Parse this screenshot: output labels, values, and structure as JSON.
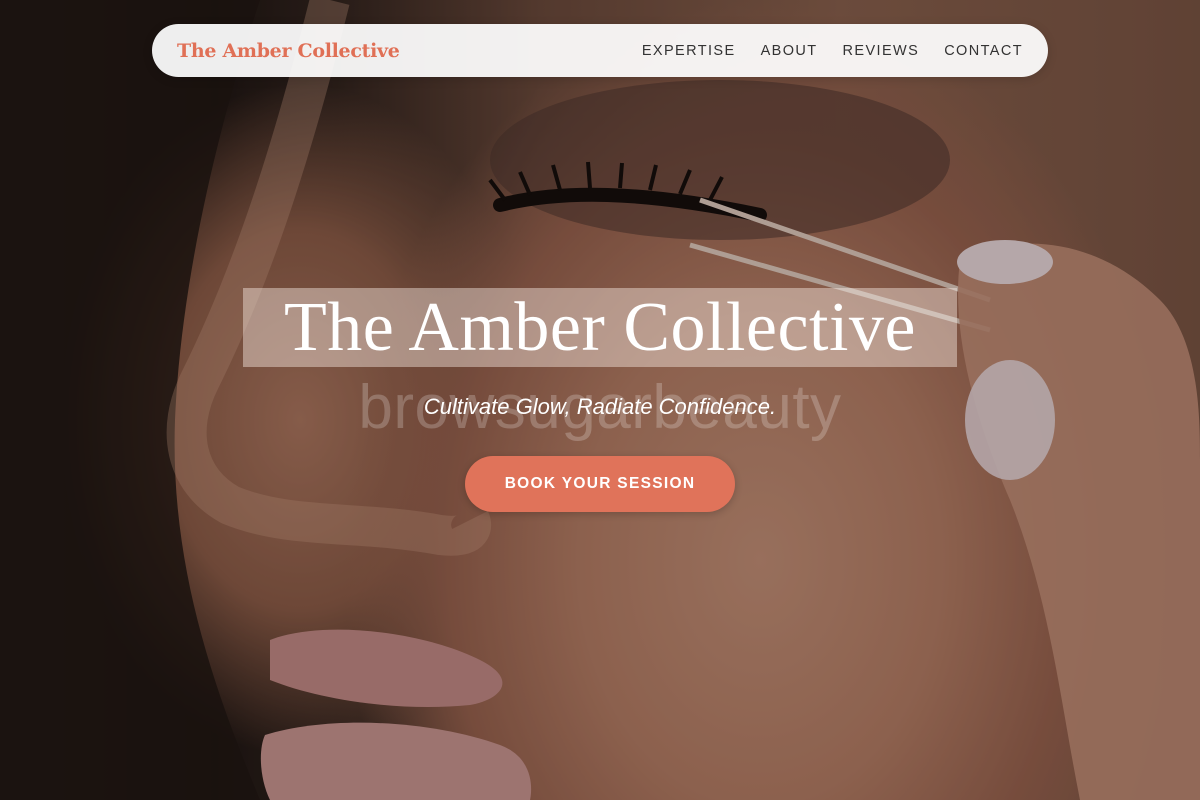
{
  "nav": {
    "brand": "The Amber Collective",
    "links": [
      {
        "label": "EXPERTISE"
      },
      {
        "label": "ABOUT"
      },
      {
        "label": "REVIEWS"
      },
      {
        "label": "CONTACT"
      }
    ]
  },
  "hero": {
    "title": "The Amber Collective",
    "watermark": "browsugarbeauty",
    "tagline": "Cultivate Glow, Radiate Confidence.",
    "cta_label": "BOOK YOUR SESSION"
  },
  "colors": {
    "accent": "#e0735a",
    "brand_text": "#e07056"
  }
}
